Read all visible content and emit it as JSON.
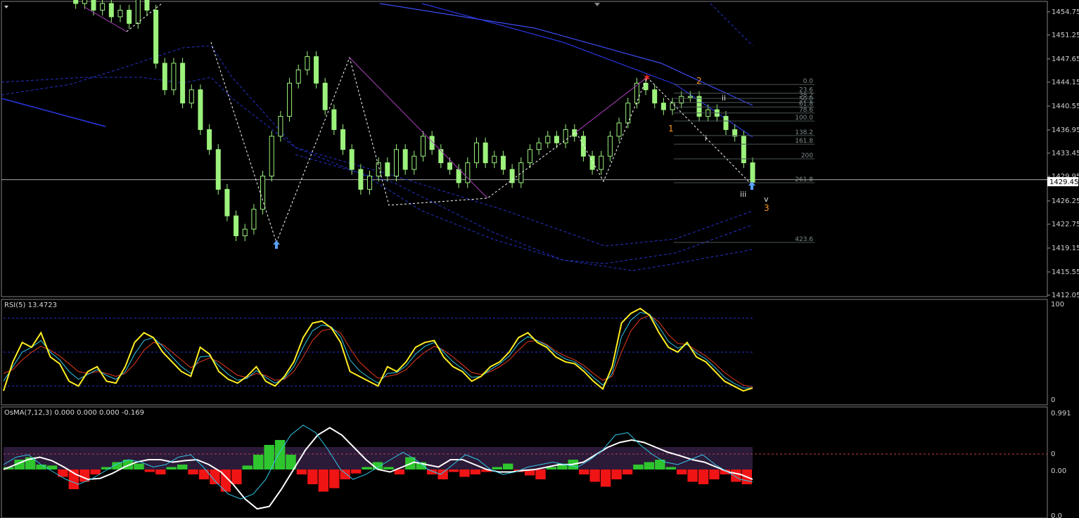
{
  "chart_data": [
    {
      "type": "line",
      "panel": "price",
      "title": "",
      "ylim": [
        1412.05,
        1456.0
      ],
      "y_ticks": [
        "1454.75",
        "1451.25",
        "1447.65",
        "1444.15",
        "1440.55",
        "1436.95",
        "1433.45",
        "1429.95",
        "1426.25",
        "1422.75",
        "1419.15",
        "1415.55",
        "1412.05"
      ],
      "current_price_label": "1429.45",
      "current_price": 1429.45,
      "series": [
        {
          "type": "candles-line",
          "color": "#9cf27c",
          "values": [
            1458,
            1456,
            1457,
            1455,
            1456,
            1454,
            1455,
            1453,
            1457,
            1455,
            1447,
            1443,
            1447,
            1441,
            1443,
            1437,
            1434,
            1428,
            1424,
            1421,
            1422,
            1425,
            1430,
            1436,
            1439,
            1444,
            1446,
            1448,
            1444,
            1440,
            1437,
            1434,
            1431,
            1428,
            1430,
            1432,
            1430,
            1434,
            1431,
            1433,
            1436,
            1434,
            1432,
            1431,
            1429,
            1432,
            1435,
            1432,
            1433,
            1431,
            1429,
            1432,
            1434,
            1435,
            1436,
            1435,
            1437,
            1436,
            1433,
            1431,
            1433,
            1436,
            1438,
            1441,
            1444,
            1443,
            1441,
            1440,
            1441,
            1442,
            1442,
            1439,
            1440,
            1439,
            1437,
            1436,
            1432,
            1429
          ]
        },
        {
          "name": "",
          "color": "#2233ee",
          "style": "solid",
          "values": [
            1456,
            1455.8,
            1455.4,
            1455.0,
            1454.6,
            1454.2,
            1453.8,
            1453.4,
            1453.0,
            1452.6,
            1452.2,
            1451.8,
            1451.4,
            1451.0,
            1450.6,
            1450.2,
            1449.8,
            1449.4,
            1449.0,
            1448.6,
            1448.2,
            1447.8,
            1447.4,
            1447.0,
            1446.6,
            1446.2,
            1445.8,
            1445.4,
            1445.0,
            1444.6,
            1444.2,
            1443.9,
            1443.6,
            1443.3,
            1443.0,
            1442.7,
            1442.4
          ]
        }
      ],
      "fibonacci": {
        "levels": [
          "0.0",
          "23.6",
          "38.2",
          "50.0",
          "61.8",
          "78.6",
          "100.0",
          "138.2",
          "161.8",
          "200",
          "261.8",
          "423.6"
        ],
        "values": [
          1443.8,
          1442.5,
          1441.7,
          1441.1,
          1440.4,
          1439.5,
          1438.3,
          1436.1,
          1434.8,
          1432.6,
          1429.0,
          1420.0
        ]
      },
      "wave_labels": {
        "orange": [
          "1",
          "2",
          "3"
        ],
        "white": [
          "i",
          "ii",
          "iii",
          "v"
        ]
      }
    },
    {
      "type": "line",
      "panel": "rsi",
      "title": "RSI(5) 13.4723",
      "ylim": [
        0,
        100
      ],
      "y_ticks": [
        "100",
        "0"
      ],
      "levels": [
        85,
        50,
        15
      ],
      "series": [
        {
          "name": "",
          "color": "#ffee22",
          "values": [
            10,
            40,
            60,
            55,
            70,
            45,
            38,
            20,
            15,
            30,
            35,
            20,
            18,
            35,
            60,
            70,
            65,
            50,
            40,
            30,
            25,
            55,
            48,
            30,
            22,
            18,
            25,
            35,
            20,
            15,
            25,
            40,
            65,
            80,
            82,
            75,
            60,
            30,
            25,
            20,
            15,
            35,
            30,
            40,
            55,
            60,
            62,
            45,
            35,
            30,
            20,
            25,
            35,
            40,
            50,
            65,
            70,
            60,
            55,
            45,
            40,
            38,
            30,
            20,
            12,
            35,
            80,
            90,
            95,
            88,
            70,
            55,
            50,
            60,
            45,
            40,
            30,
            20,
            15,
            10,
            13
          ]
        },
        {
          "name": "",
          "color": "#30c8e8",
          "values": [
            20,
            35,
            50,
            55,
            62,
            50,
            42,
            30,
            22,
            27,
            32,
            26,
            22,
            30,
            48,
            62,
            65,
            56,
            45,
            35,
            28,
            45,
            46,
            36,
            27,
            21,
            23,
            31,
            24,
            18,
            23,
            35,
            55,
            72,
            78,
            76,
            66,
            42,
            31,
            24,
            18,
            28,
            29,
            36,
            48,
            56,
            60,
            50,
            40,
            33,
            24,
            25,
            32,
            38,
            46,
            59,
            66,
            62,
            57,
            49,
            43,
            40,
            33,
            24,
            16,
            28,
            66,
            83,
            91,
            89,
            76,
            61,
            54,
            58,
            49,
            43,
            34,
            24,
            18,
            13,
            13
          ]
        },
        {
          "name": "",
          "color": "#e53a1a",
          "values": [
            28,
            32,
            42,
            50,
            56,
            52,
            46,
            38,
            30,
            28,
            30,
            28,
            25,
            28,
            38,
            52,
            60,
            58,
            50,
            42,
            34,
            40,
            44,
            40,
            33,
            26,
            24,
            28,
            26,
            21,
            22,
            30,
            45,
            62,
            72,
            74,
            70,
            54,
            40,
            31,
            23,
            25,
            27,
            32,
            42,
            50,
            56,
            52,
            45,
            37,
            29,
            27,
            30,
            35,
            42,
            52,
            61,
            62,
            58,
            51,
            46,
            42,
            36,
            28,
            21,
            25,
            50,
            72,
            84,
            88,
            81,
            68,
            59,
            58,
            52,
            46,
            38,
            29,
            22,
            16,
            14
          ]
        }
      ]
    },
    {
      "type": "bar",
      "panel": "osma",
      "title": "OsMA(7,12,3) 0.000 0.000 0.000 -0.169",
      "y_ticks": [
        "0.991",
        "0",
        "0.00",
        "0.0"
      ],
      "ylim": [
        -1.0,
        1.0
      ],
      "series": [
        {
          "name": "",
          "color_pos": "#2ec52e",
          "color_neg": "#f01414",
          "values": [
            0.05,
            0.2,
            0.25,
            0.1,
            0.08,
            -0.15,
            -0.4,
            -0.25,
            -0.1,
            0.05,
            0.15,
            0.2,
            0.12,
            -0.05,
            -0.1,
            0.05,
            0.1,
            -0.1,
            -0.2,
            -0.3,
            -0.45,
            -0.3,
            0.08,
            0.3,
            0.5,
            0.6,
            0.3,
            -0.1,
            -0.3,
            -0.45,
            -0.38,
            -0.2,
            -0.08,
            0.05,
            0.15,
            0.05,
            -0.1,
            0.25,
            0.15,
            -0.1,
            -0.2,
            -0.05,
            -0.15,
            -0.1,
            -0.05,
            0.05,
            0.12,
            -0.05,
            -0.12,
            -0.2,
            0.05,
            0.12,
            0.2,
            -0.1,
            -0.25,
            -0.35,
            -0.2,
            -0.1,
            0.1,
            0.15,
            0.2,
            0.05,
            -0.1,
            -0.25,
            -0.3,
            -0.2,
            -0.1,
            -0.25,
            -0.3
          ]
        },
        {
          "name": "",
          "color": "#ffffff",
          "values": [
            0.0,
            0.1,
            0.2,
            0.25,
            0.18,
            0.05,
            -0.1,
            -0.2,
            -0.18,
            -0.08,
            0.05,
            0.15,
            0.2,
            0.2,
            0.15,
            0.18,
            0.2,
            0.1,
            -0.05,
            -0.3,
            -0.6,
            -0.8,
            -0.75,
            -0.4,
            0.0,
            0.4,
            0.7,
            0.85,
            0.7,
            0.45,
            0.2,
            0.0,
            -0.05,
            0.05,
            0.15,
            0.1,
            0.05,
            0.2,
            0.2,
            0.1,
            0.0,
            -0.05,
            -0.05,
            -0.02,
            0.0,
            0.05,
            0.1,
            0.1,
            0.15,
            0.3,
            0.45,
            0.55,
            0.6,
            0.55,
            0.45,
            0.35,
            0.28,
            0.2,
            0.15,
            0.05,
            -0.05,
            -0.1,
            -0.2
          ]
        },
        {
          "name": "",
          "color": "#30c8e8",
          "values": [
            0.1,
            0.25,
            0.3,
            0.1,
            -0.05,
            -0.2,
            -0.3,
            -0.2,
            -0.05,
            0.1,
            0.2,
            0.15,
            0.05,
            0.1,
            0.25,
            0.3,
            0.05,
            -0.25,
            -0.5,
            -0.6,
            -0.5,
            -0.2,
            0.3,
            0.7,
            0.9,
            0.75,
            0.4,
            0.0,
            -0.2,
            -0.1,
            0.05,
            0.2,
            0.35,
            0.2,
            0.0,
            -0.1,
            0.1,
            0.3,
            0.2,
            0.0,
            -0.1,
            -0.05,
            0.05,
            0.1,
            0.15,
            0.1,
            0.05,
            0.2,
            0.4,
            0.7,
            0.75,
            0.5,
            0.3,
            0.15,
            0.1,
            0.2,
            0.3,
            0.1,
            -0.05,
            -0.2,
            -0.25
          ]
        }
      ]
    }
  ]
}
